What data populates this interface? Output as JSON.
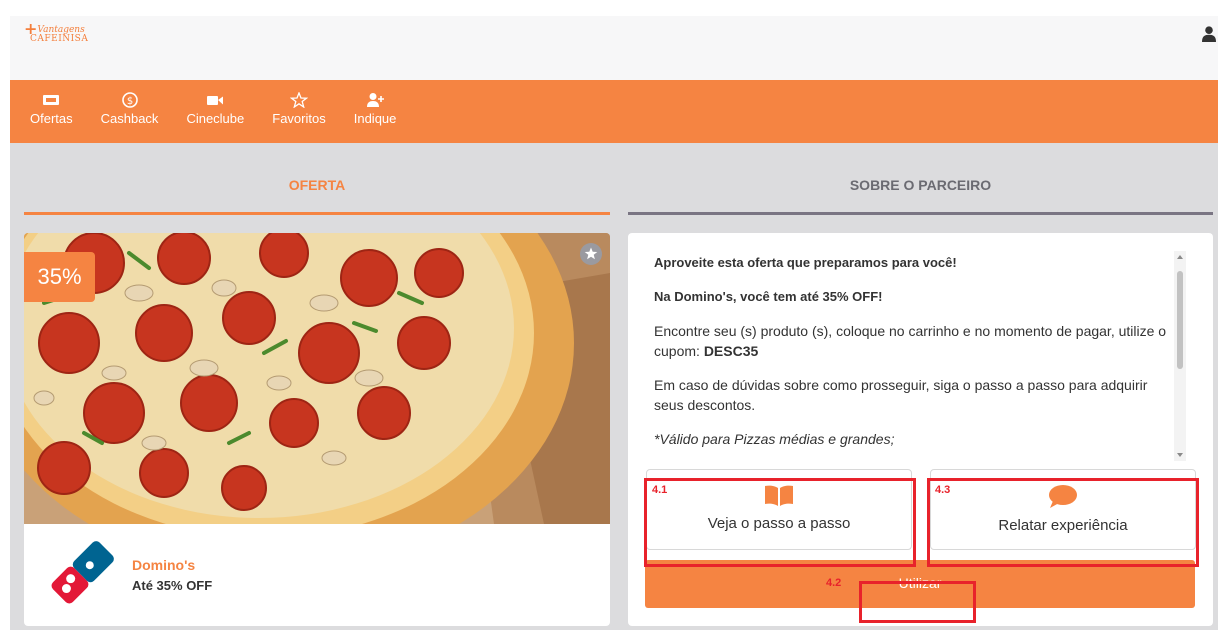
{
  "brand": {
    "logo_line1": "Vantagens",
    "logo_line2": "CAFEINISA",
    "accent_color": "#f58442",
    "highlight_color": "#e8222b"
  },
  "nav": {
    "items": [
      {
        "label": "Ofertas",
        "icon": "ticket-icon"
      },
      {
        "label": "Cashback",
        "icon": "dollar-coin-icon"
      },
      {
        "label": "Cineclube",
        "icon": "video-camera-icon"
      },
      {
        "label": "Favoritos",
        "icon": "star-outline-icon"
      },
      {
        "label": "Indique",
        "icon": "user-plus-icon"
      }
    ]
  },
  "tabs": {
    "offer": "OFERTA",
    "partner": "SOBRE O PARCEIRO"
  },
  "offer": {
    "discount_badge": "35%",
    "partner_name": "Domino's",
    "deal": "Até 35% OFF"
  },
  "description": {
    "intro": "Aproveite esta oferta que preparamos para você!",
    "headline": "Na Domino's, você tem até 35% OFF!",
    "instructions": "Encontre seu (s) produto (s), coloque no carrinho e no momento de pagar, utilize o cupom: ",
    "coupon": "DESC35",
    "help": "Em caso de dúvidas sobre como prosseguir, siga o passo a passo para adquirir seus descontos.",
    "note": "*Válido para Pizzas médias e grandes;"
  },
  "actions": {
    "steps_label": "Veja o passo a passo",
    "report_label": "Relatar experiência",
    "use_label": "Utilizar"
  },
  "annotations": {
    "steps": "4.1",
    "use": "4.2",
    "report": "4.3"
  }
}
